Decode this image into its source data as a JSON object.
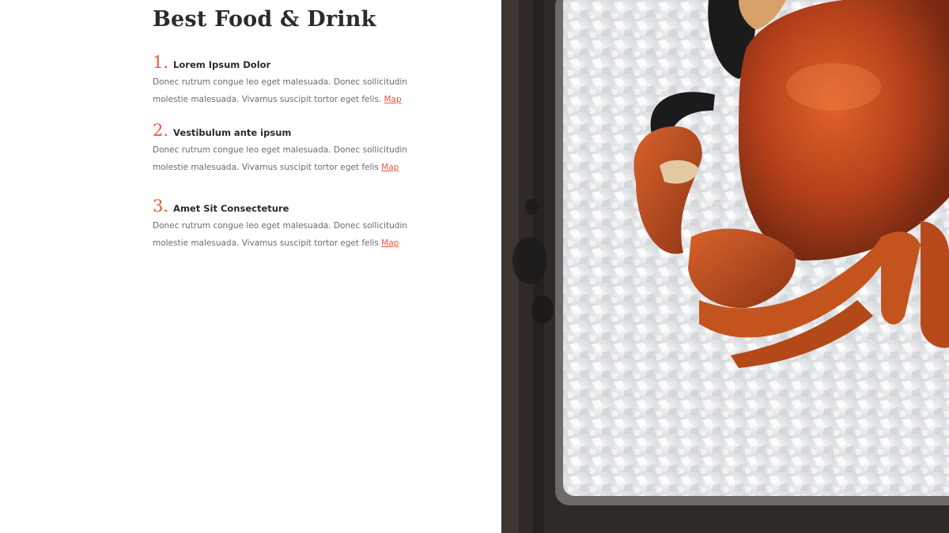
{
  "section": {
    "title": "Best Food & Drink",
    "items": [
      {
        "number": "1.",
        "title": "Lorem Ipsum Dolor",
        "description": "Donec rutrum congue leo eget malesuada. Donec sollicitudin molestie malesuada. Vivamus suscipit tortor eget felis.",
        "link_label": "Map"
      },
      {
        "number": "2.",
        "title": "Vestibulum ante ipsum",
        "description": "Donec rutrum congue leo eget malesuada. Donec sollicitudin molestie malesuada. Vivamus suscipit tortor eget felis",
        "link_label": "Map"
      },
      {
        "number": "3.",
        "title": "Amet Sit Consecteture",
        "description": "Donec rutrum congue leo eget malesuada. Donec sollicitudin molestie malesuada. Vivamus suscipit tortor eget felis",
        "link_label": "Map"
      }
    ]
  },
  "colors": {
    "accent": "#f0543c",
    "heading": "#2b2b2b",
    "body_text": "#6b6b6b",
    "background": "#ffffff"
  },
  "image": {
    "subject": "crab-on-ice-tray"
  }
}
